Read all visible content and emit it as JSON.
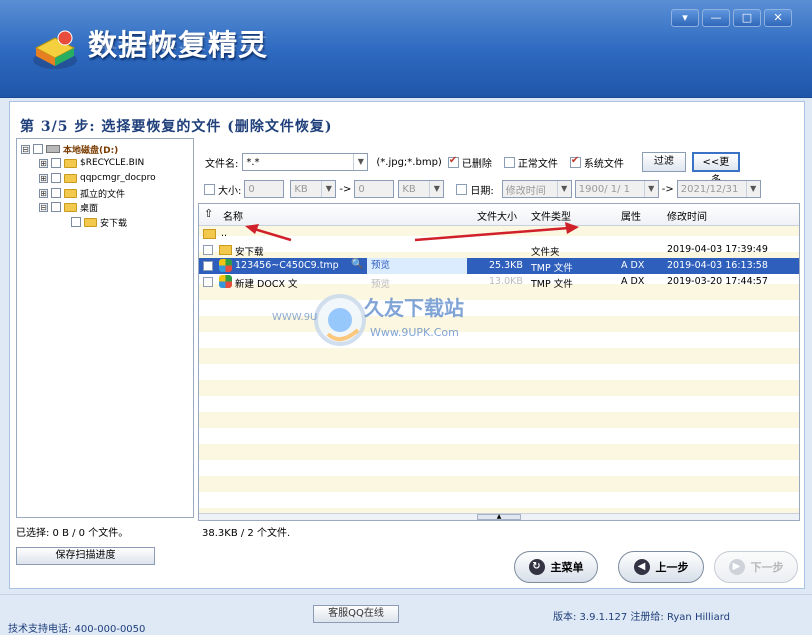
{
  "app": {
    "title": "数据恢复精灵",
    "window_controls": [
      "▾",
      "—",
      "□",
      "✕"
    ]
  },
  "step_title": "第 3/5 步: 选择要恢复的文件 (删除文件恢复)",
  "tree": {
    "items": [
      {
        "label": "本地磁盘(D:)",
        "expander": "⊟"
      },
      {
        "label": "$RECYCLE.BIN",
        "expander": "⊞"
      },
      {
        "label": "qqpcmgr_docpro",
        "expander": "⊞"
      },
      {
        "label": "孤立的文件",
        "expander": "⊞"
      },
      {
        "label": "桌面",
        "expander": "⊟"
      },
      {
        "label": "安下载",
        "expander": ""
      }
    ]
  },
  "filter": {
    "filename_label": "文件名:",
    "filename_value": "*.*",
    "filename_hint": "(*.jpg;*.bmp)",
    "deleted_label": "已删除",
    "normal_label": "正常文件",
    "system_label": "系统文件",
    "filter_button": "过滤",
    "more_button": "<<更多",
    "size_label": "大小:",
    "size_from": "0",
    "size_unit_from": "KB",
    "size_arrow": "->",
    "size_to": "0",
    "size_unit_to": "KB",
    "date_label": "日期:",
    "date_type": "修改时间",
    "date_from": "1900/ 1/ 1",
    "date_arrow": "->",
    "date_to": "2021/12/31"
  },
  "list": {
    "headers": {
      "name": "名称",
      "size": "文件大小",
      "type": "文件类型",
      "attr": "属性",
      "mtime": "修改时间"
    },
    "parent_dir": "..",
    "rows": [
      {
        "name": "安下载",
        "size": "",
        "type": "文件夹",
        "attr": "",
        "mtime": "2019-04-03 17:39:49"
      },
      {
        "name": "123456~C450C9.tmp",
        "preview": "预览",
        "size": "25.3KB",
        "type": "TMP 文件",
        "attr": "A DX",
        "mtime": "2019-04-03 16:13:58"
      },
      {
        "name": "新建 DOCX 文",
        "preview": "预览",
        "size": "13.0KB",
        "type": "TMP 文件",
        "attr": "A DX",
        "mtime": "2019-03-20 17:44:57"
      }
    ]
  },
  "status": {
    "selected": "已选择: 0 B / 0 个文件。",
    "total": "38.3KB / 2 个文件."
  },
  "watermark": {
    "brand": "久友下载站",
    "url_left": "WWW.9U",
    "url_right": "Www.9UPK.Com"
  },
  "buttons": {
    "save_scan": "保存扫描进度",
    "main_menu": "主菜单",
    "prev": "上一步",
    "next": "下一步",
    "qq": "客服QQ在线"
  },
  "footer": {
    "version": "版本: 3.9.1.127 注册给: Ryan Hilliard",
    "support": "技术支持电话: 400-000-0050"
  }
}
